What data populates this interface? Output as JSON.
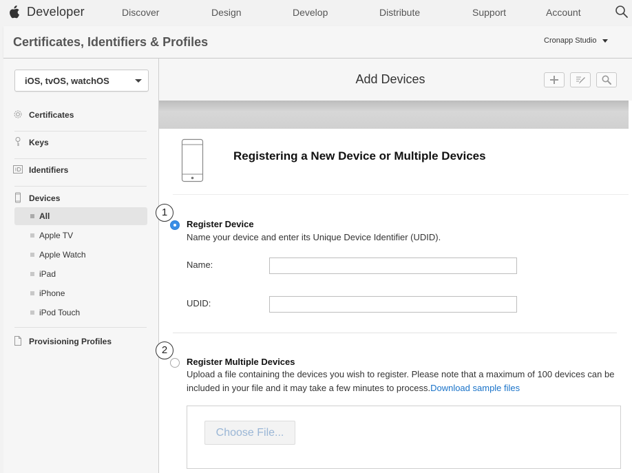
{
  "topnav": {
    "brand": "Developer",
    "links": [
      "Discover",
      "Design",
      "Develop",
      "Distribute",
      "Support",
      "Account"
    ],
    "icons": {
      "logo": "apple-logo-icon",
      "search": "search-icon"
    }
  },
  "header": {
    "title": "Certificates, Identifiers & Profiles",
    "team": "Cronapp Studio"
  },
  "sidebar": {
    "platform": "iOS, tvOS, watchOS",
    "sections": [
      {
        "label": "Certificates",
        "icon": "certificate-icon"
      },
      {
        "label": "Keys",
        "icon": "key-icon"
      },
      {
        "label": "Identifiers",
        "icon": "id-icon"
      },
      {
        "label": "Devices",
        "icon": "device-icon"
      },
      {
        "label": "Provisioning Profiles",
        "icon": "document-icon"
      }
    ],
    "devices": [
      "All",
      "Apple TV",
      "Apple Watch",
      "iPad",
      "iPhone",
      "iPod Touch"
    ],
    "active_device": "All"
  },
  "main": {
    "title": "Add Devices",
    "toolbar_icons": [
      "plus-icon",
      "edit-icon",
      "search-icon"
    ],
    "section_title": "Registering a New Device or Multiple Devices",
    "step1": {
      "number": "1",
      "title": "Register Device",
      "desc": "Name your device and enter its Unique Device Identifier (UDID).",
      "name_label": "Name:",
      "name_value": "",
      "udid_label": "UDID:",
      "udid_value": "",
      "selected": true
    },
    "step2": {
      "number": "2",
      "title": "Register Multiple Devices",
      "desc": "Upload a file containing the devices you wish to register. Please note that a maximum of 100 devices can be included in your file and it may take a few minutes to process.",
      "link": "Download sample files",
      "choose_label": "Choose File...",
      "selected": false
    }
  },
  "colors": {
    "accent_blue": "#3a8ee6",
    "link_blue": "#1a73c9",
    "header_bg": "#f6f6f6"
  }
}
